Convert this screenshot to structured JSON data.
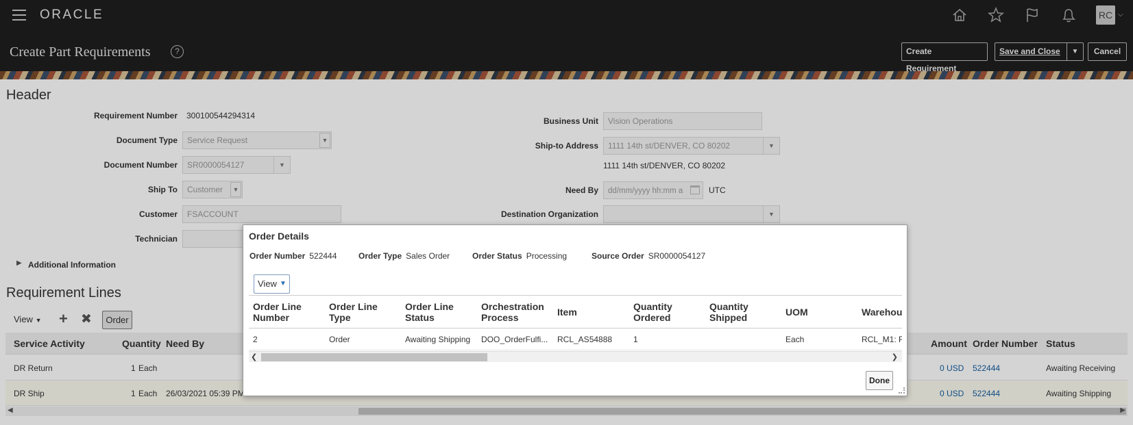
{
  "topbar": {
    "brand": "ORACLE",
    "icons": [
      "home-icon",
      "star-icon",
      "flag-icon",
      "notifications-icon"
    ],
    "avatar": "RC"
  },
  "titlebar": {
    "title": "Create Part Requirements",
    "help": "?",
    "create_requirement": "Create Requirement",
    "save_and_close": "Save and Close",
    "cancel": "Cancel"
  },
  "header": {
    "section_title": "Header",
    "requirement_number_label": "Requirement Number",
    "requirement_number": "300100544294314",
    "document_type_label": "Document Type",
    "document_type": "Service Request",
    "document_number_label": "Document Number",
    "document_number": "SR0000054127",
    "ship_to_label": "Ship To",
    "ship_to": "Customer",
    "customer_label": "Customer",
    "customer": "FSACCOUNT",
    "technician_label": "Technician",
    "business_unit_label": "Business Unit",
    "business_unit": "Vision Operations",
    "ship_to_address_label": "Ship-to Address",
    "ship_to_address": "1111 14th st/DENVER, CO 80202",
    "ship_to_address_text": "1111 14th st/DENVER, CO 80202",
    "need_by_label": "Need By",
    "need_by_placeholder": "dd/mm/yyyy hh:mm a",
    "timezone": "UTC",
    "destination_org_label": "Destination Organization",
    "additional_info": "Additional Information"
  },
  "requirement_lines": {
    "section_title": "Requirement Lines",
    "view_label": "View",
    "order_button": "Order",
    "columns": {
      "service_activity": "Service Activity",
      "quantity": "Quantity",
      "need_by": "Need By",
      "amount": "Amount",
      "order_number": "Order Number",
      "status": "Status"
    },
    "rows": [
      {
        "service_activity": "DR Return",
        "quantity": "1",
        "uom": "Each",
        "need_by": "",
        "amount": "0 USD",
        "order_number": "522444",
        "status": "Awaiting Receiving"
      },
      {
        "service_activity": "DR Ship",
        "quantity": "1",
        "uom": "Each",
        "need_by": "26/03/2021 05:39 PM",
        "amount": "0 USD",
        "order_number": "522444",
        "status": "Awaiting Shipping"
      }
    ]
  },
  "dialog": {
    "title": "Order Details",
    "order_number_label": "Order Number",
    "order_number": "522444",
    "order_type_label": "Order Type",
    "order_type": "Sales Order",
    "order_status_label": "Order Status",
    "order_status": "Processing",
    "source_order_label": "Source Order",
    "source_order": "SR0000054127",
    "view_label": "View",
    "columns": {
      "line_number": "Order Line Number",
      "line_type": "Order Line Type",
      "line_status": "Order Line Status",
      "orchestration_process": "Orchestration Process",
      "item": "Item",
      "quantity_ordered": "Quantity Ordered",
      "quantity_shipped": "Quantity Shipped",
      "uom": "UOM",
      "warehouse": "Warehou"
    },
    "row": {
      "line_number": "2",
      "line_type": "Order",
      "line_status": "Awaiting Shipping",
      "orchestration_process": "DOO_OrderFulfi...",
      "item": "RCL_AS54888",
      "quantity_ordered": "1",
      "quantity_shipped": "",
      "uom": "Each",
      "warehouse": "RCL_M1: F"
    },
    "done": "Done"
  }
}
